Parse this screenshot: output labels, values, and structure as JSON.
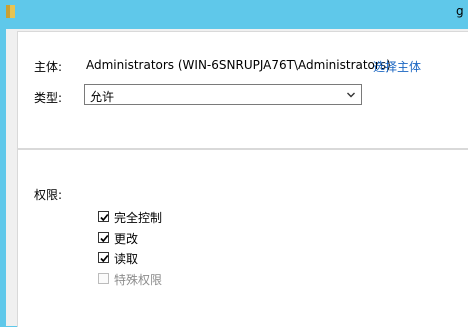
{
  "window": {
    "title_fragment": "g",
    "folder_icon": "folder-icon"
  },
  "principal": {
    "label": "主体:",
    "value": "Administrators (WIN-6SNRUPJA76T\\Administrators)",
    "select_link": "选择主体"
  },
  "type": {
    "label": "类型:",
    "selected": "允许",
    "chevron_icon": "chevron-down-icon"
  },
  "permissions": {
    "label": "权限:",
    "items": [
      {
        "label": "完全控制",
        "checked": true,
        "enabled": true
      },
      {
        "label": "更改",
        "checked": true,
        "enabled": true
      },
      {
        "label": "读取",
        "checked": true,
        "enabled": true
      },
      {
        "label": "特殊权限",
        "checked": false,
        "enabled": false
      }
    ]
  }
}
